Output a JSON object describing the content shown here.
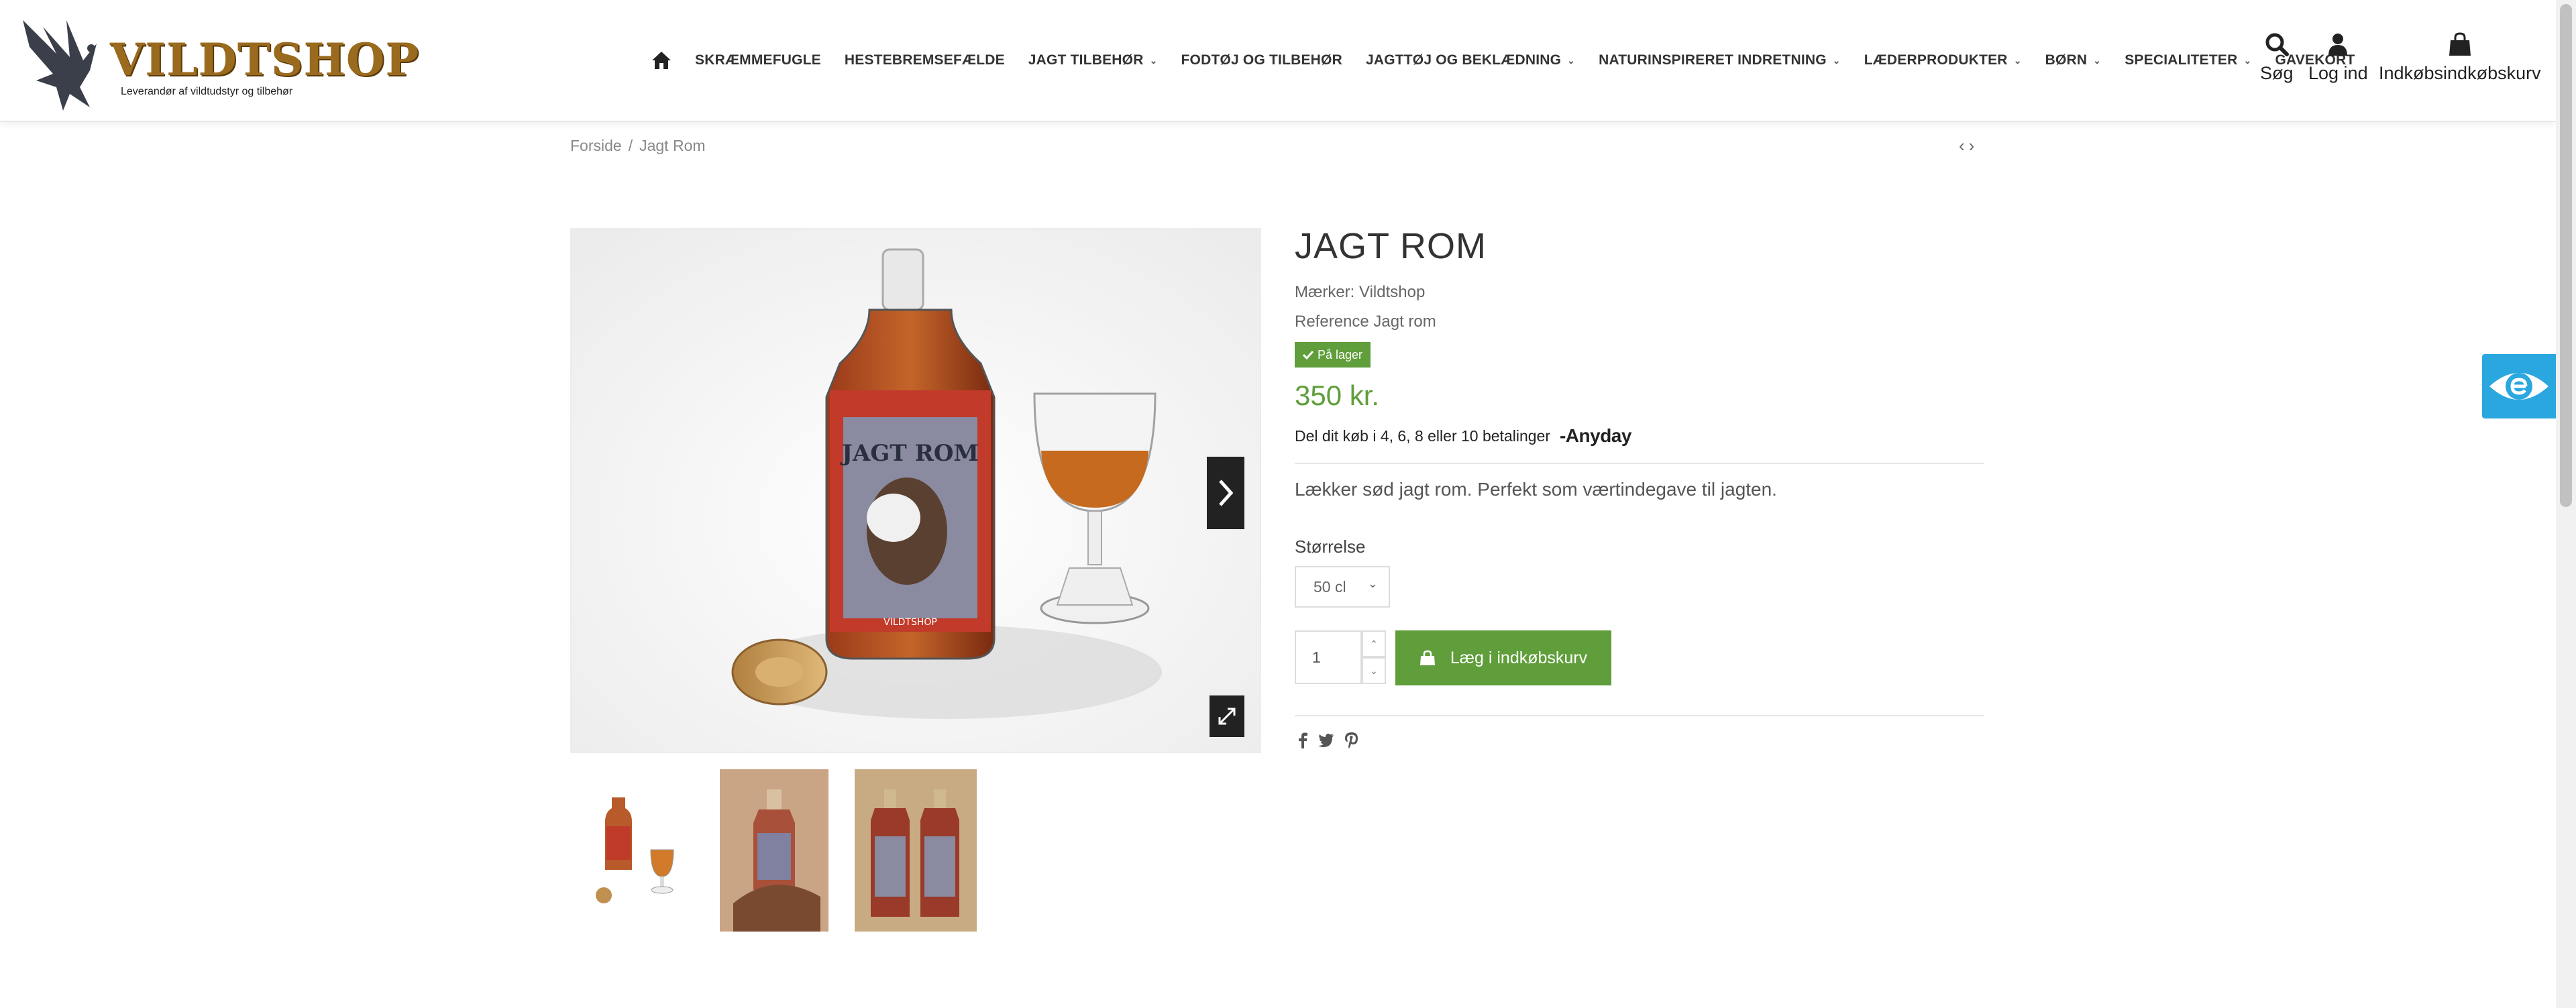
{
  "logo": {
    "name": "VILDTSHOP",
    "tagline": "Leverandør af vildtudstyr og tilbehør"
  },
  "nav": {
    "items": [
      {
        "label": "SKRÆMMEFUGLE",
        "has_dropdown": false
      },
      {
        "label": "HESTEBREMSEFÆLDE",
        "has_dropdown": false
      },
      {
        "label": "JAGT TILBEHØR",
        "has_dropdown": true
      },
      {
        "label": "FODTØJ OG TILBEHØR",
        "has_dropdown": false
      },
      {
        "label": "JAGTTØJ OG BEKLÆDNING",
        "has_dropdown": true
      },
      {
        "label": "NATURINSPIRERET INDRETNING",
        "has_dropdown": true
      },
      {
        "label": "LÆDERPRODUKTER",
        "has_dropdown": true
      },
      {
        "label": "BØRN",
        "has_dropdown": true
      },
      {
        "label": "SPECIALITETER",
        "has_dropdown": true
      },
      {
        "label": "GAVEKORT",
        "has_dropdown": false
      }
    ]
  },
  "header_actions": {
    "search": "Søg",
    "login": "Log ind",
    "cart": "Indkøbsindkøbskurv"
  },
  "breadcrumb": {
    "home": "Forside",
    "separator": "/",
    "current": "Jagt Rom"
  },
  "product": {
    "title": "JAGT ROM",
    "brand_line": "Mærker: Vildtshop",
    "reference_line": "Reference Jagt rom",
    "stock": "På lager",
    "price": "350 kr.",
    "installments": "Del dit køb i 4, 6, 8 eller 10 betalinger",
    "installments_brand": "-Anyday",
    "bottle_label": "JAGT ROM",
    "bottle_brand": "VILDTSHOP",
    "description": "Lækker sød jagt rom. Perfekt som værtindegave til jagten.",
    "size_label": "Størrelse",
    "size_value": "50 cl",
    "quantity": "1",
    "add_to_cart": "Læg i indkøbskurv"
  },
  "colors": {
    "accent_green": "#5f9e3a",
    "access_blue": "#2aa7df",
    "logo_gold": "#9a6a1e"
  }
}
